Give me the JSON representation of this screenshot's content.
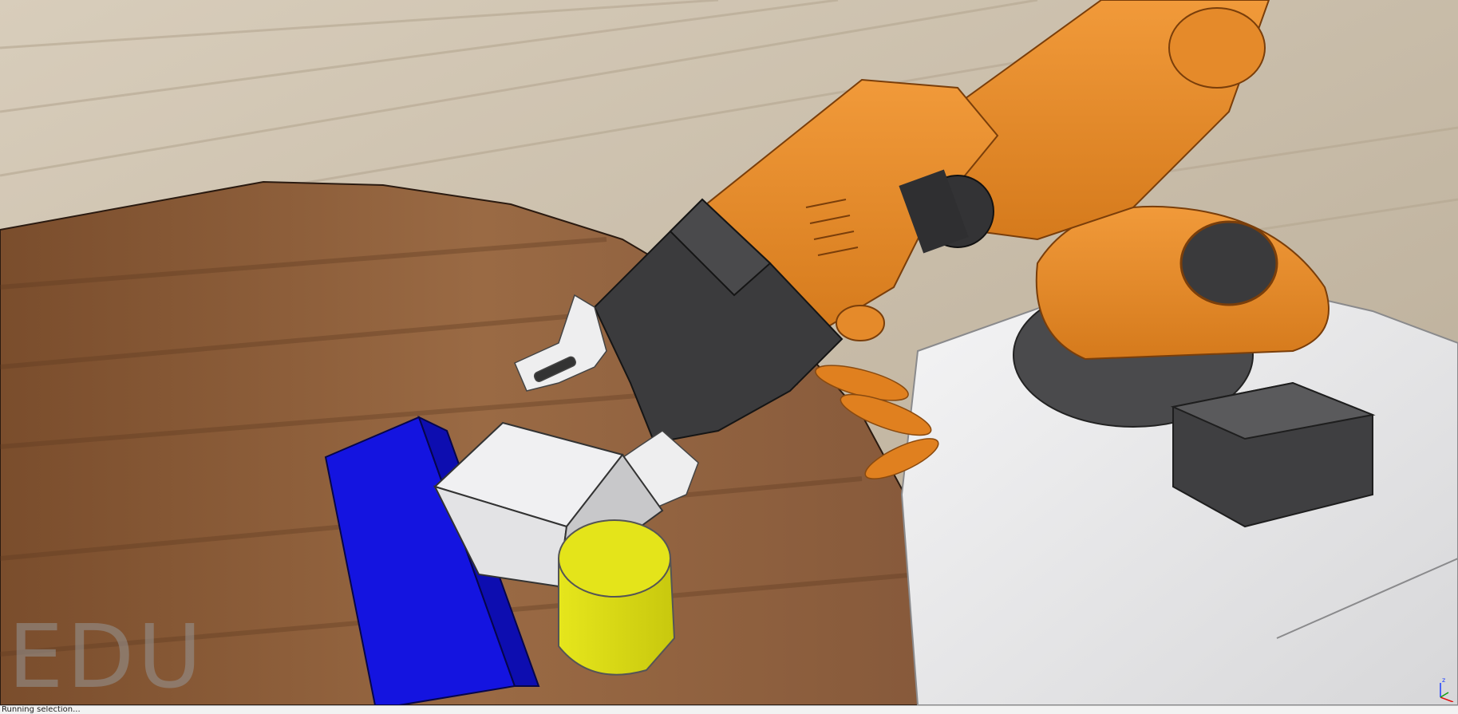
{
  "viewport": {
    "watermark": "EDU",
    "colors": {
      "floor": "#cfc4b2",
      "table": "#8a5a36",
      "robot_arm": "#e58a2a",
      "robot_base": "#e9e9ea",
      "tool_dark": "#3b3b3d",
      "blue_box": "#1414e0",
      "white_cube": "#e8e8ea",
      "yellow_cylinder": "#dede14"
    },
    "objects": [
      "robot-arm",
      "gripper",
      "blue-box",
      "white-cube",
      "yellow-cylinder",
      "table"
    ],
    "axis_gizmo": {
      "z_label": "z"
    }
  },
  "statusbar": {
    "text": "Running selection..."
  }
}
